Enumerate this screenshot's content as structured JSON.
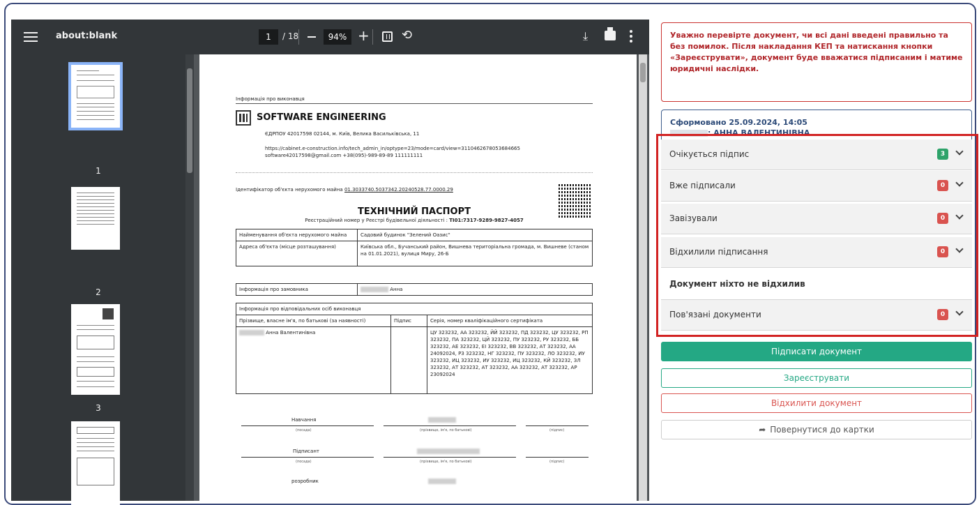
{
  "viewer": {
    "title": "about:blank",
    "page_current": "1",
    "page_total": "/ 18",
    "zoom": "94%",
    "thumbnails": [
      "1",
      "2",
      "3"
    ],
    "selected_page": 1
  },
  "document": {
    "executor_info_label": "Інформація про виконавця",
    "company_name": "SOFTWARE ENGINEERING",
    "edrpou": "ЄДРПОУ 42017598 02144, м. Київ, Велика Васильківська, 11",
    "url": "https://cabinet.e-construction.info/tech_admin_in/optype=23/mode=card/view=3110462678053684665",
    "contacts": "software42017598@gmail.com +38(095)-989-89-89 111111111",
    "ident_label": "Ідентифікатор об'єкта нерухомого майна",
    "ident_value": "01.3033740.5037342.20240528.77.0000.29",
    "title": "ТЕХНІЧНИЙ ПАСПОРТ",
    "reg_label": "Реєстраційний номер у Реєстрі будівельної діяльності :",
    "reg_value": "ТІ01:7317-9289-9827-4057",
    "name_label": "Найменування об'єкта нерухомого майна",
    "name_value": "Садовий будинок \"Зелений Оазис\"",
    "address_label": "Адреса об'єкта (місце розташування)",
    "address_value": "Київська обл., Бучанський район, Вишнева територіальна громада, м. Вишневе (станом на 01.01.2021), вулиця Миру, 26-Б",
    "customer_label": "Інформація про замовника",
    "customer_value": "Анна",
    "responsible_label": "Інформація про відповідальних осіб виконавця",
    "col_name": "Прізвище, власне ім'я, по батькові (за наявності)",
    "col_sign": "Підпис",
    "col_cert": "Серія, номер кваліфікаційного сертифіката",
    "person_name": "Анна Валентинівна",
    "cert_value": "ЦУ 323232, АА 323232, ЙЙ 323232, ПД 323232, ЦУ 323232, РП 323232, ПА 323232, ЦЙ 323232, ПУ 323232, РУ 323232, ББ 323232, АЕ 323232, ЕІ 323232, ВВ 323232, АТ 323232, АА 24092024, РЗ 323232, НГ 323232, ПУ 323232, ЛО 323232, ИУ 323232, ИЦ 323232, ИУ 323232, ИЦ 323232, КЙ 323232, ЗЛ 323232, АТ 323232, АТ 323232, АА 323232, АТ 323232, АР 23092024",
    "sig_rows": [
      {
        "role": "Навчання",
        "cap_pos": "(посада)",
        "cap_name": "(прізвище, ім'я, по батькові)",
        "cap_sign": "(підпис)"
      },
      {
        "role": "Підписант",
        "cap_pos": "(посада)",
        "cap_name": "(прізвище, ім'я, по батькові)",
        "cap_sign": "(підпис)"
      },
      {
        "role": "розробник"
      }
    ]
  },
  "panel": {
    "warning": "Уважно перевірте документ, чи всі дані введені правильно та без помилок. Після накладання КЕП та натискання кнопки «Зареєструвати», документ буде вважатися підписаним і матиме юридичні наслідки.",
    "formed": "Сформовано 25.09.2024, 14:05",
    "formed_by": ": АННА ВАЛЕНТИНІВНА",
    "accordion": [
      {
        "label": "Очікується підпис",
        "count": "3",
        "color": "#2ea36a"
      },
      {
        "label": "Вже підписали",
        "count": "0",
        "color": "#d9534f"
      },
      {
        "label": "Завізували",
        "count": "0",
        "color": "#d9534f"
      },
      {
        "label": "Відхилили підписання",
        "count": "0",
        "color": "#d9534f"
      }
    ],
    "no_reject": "Документ ніхто не відхилив",
    "related": {
      "label": "Пов'язані документи",
      "count": "0",
      "color": "#d9534f"
    },
    "btn_sign": "Підписати документ",
    "btn_register": "Зареєструвати",
    "btn_reject": "Відхилити документ",
    "btn_back": "Повернутися до картки"
  }
}
